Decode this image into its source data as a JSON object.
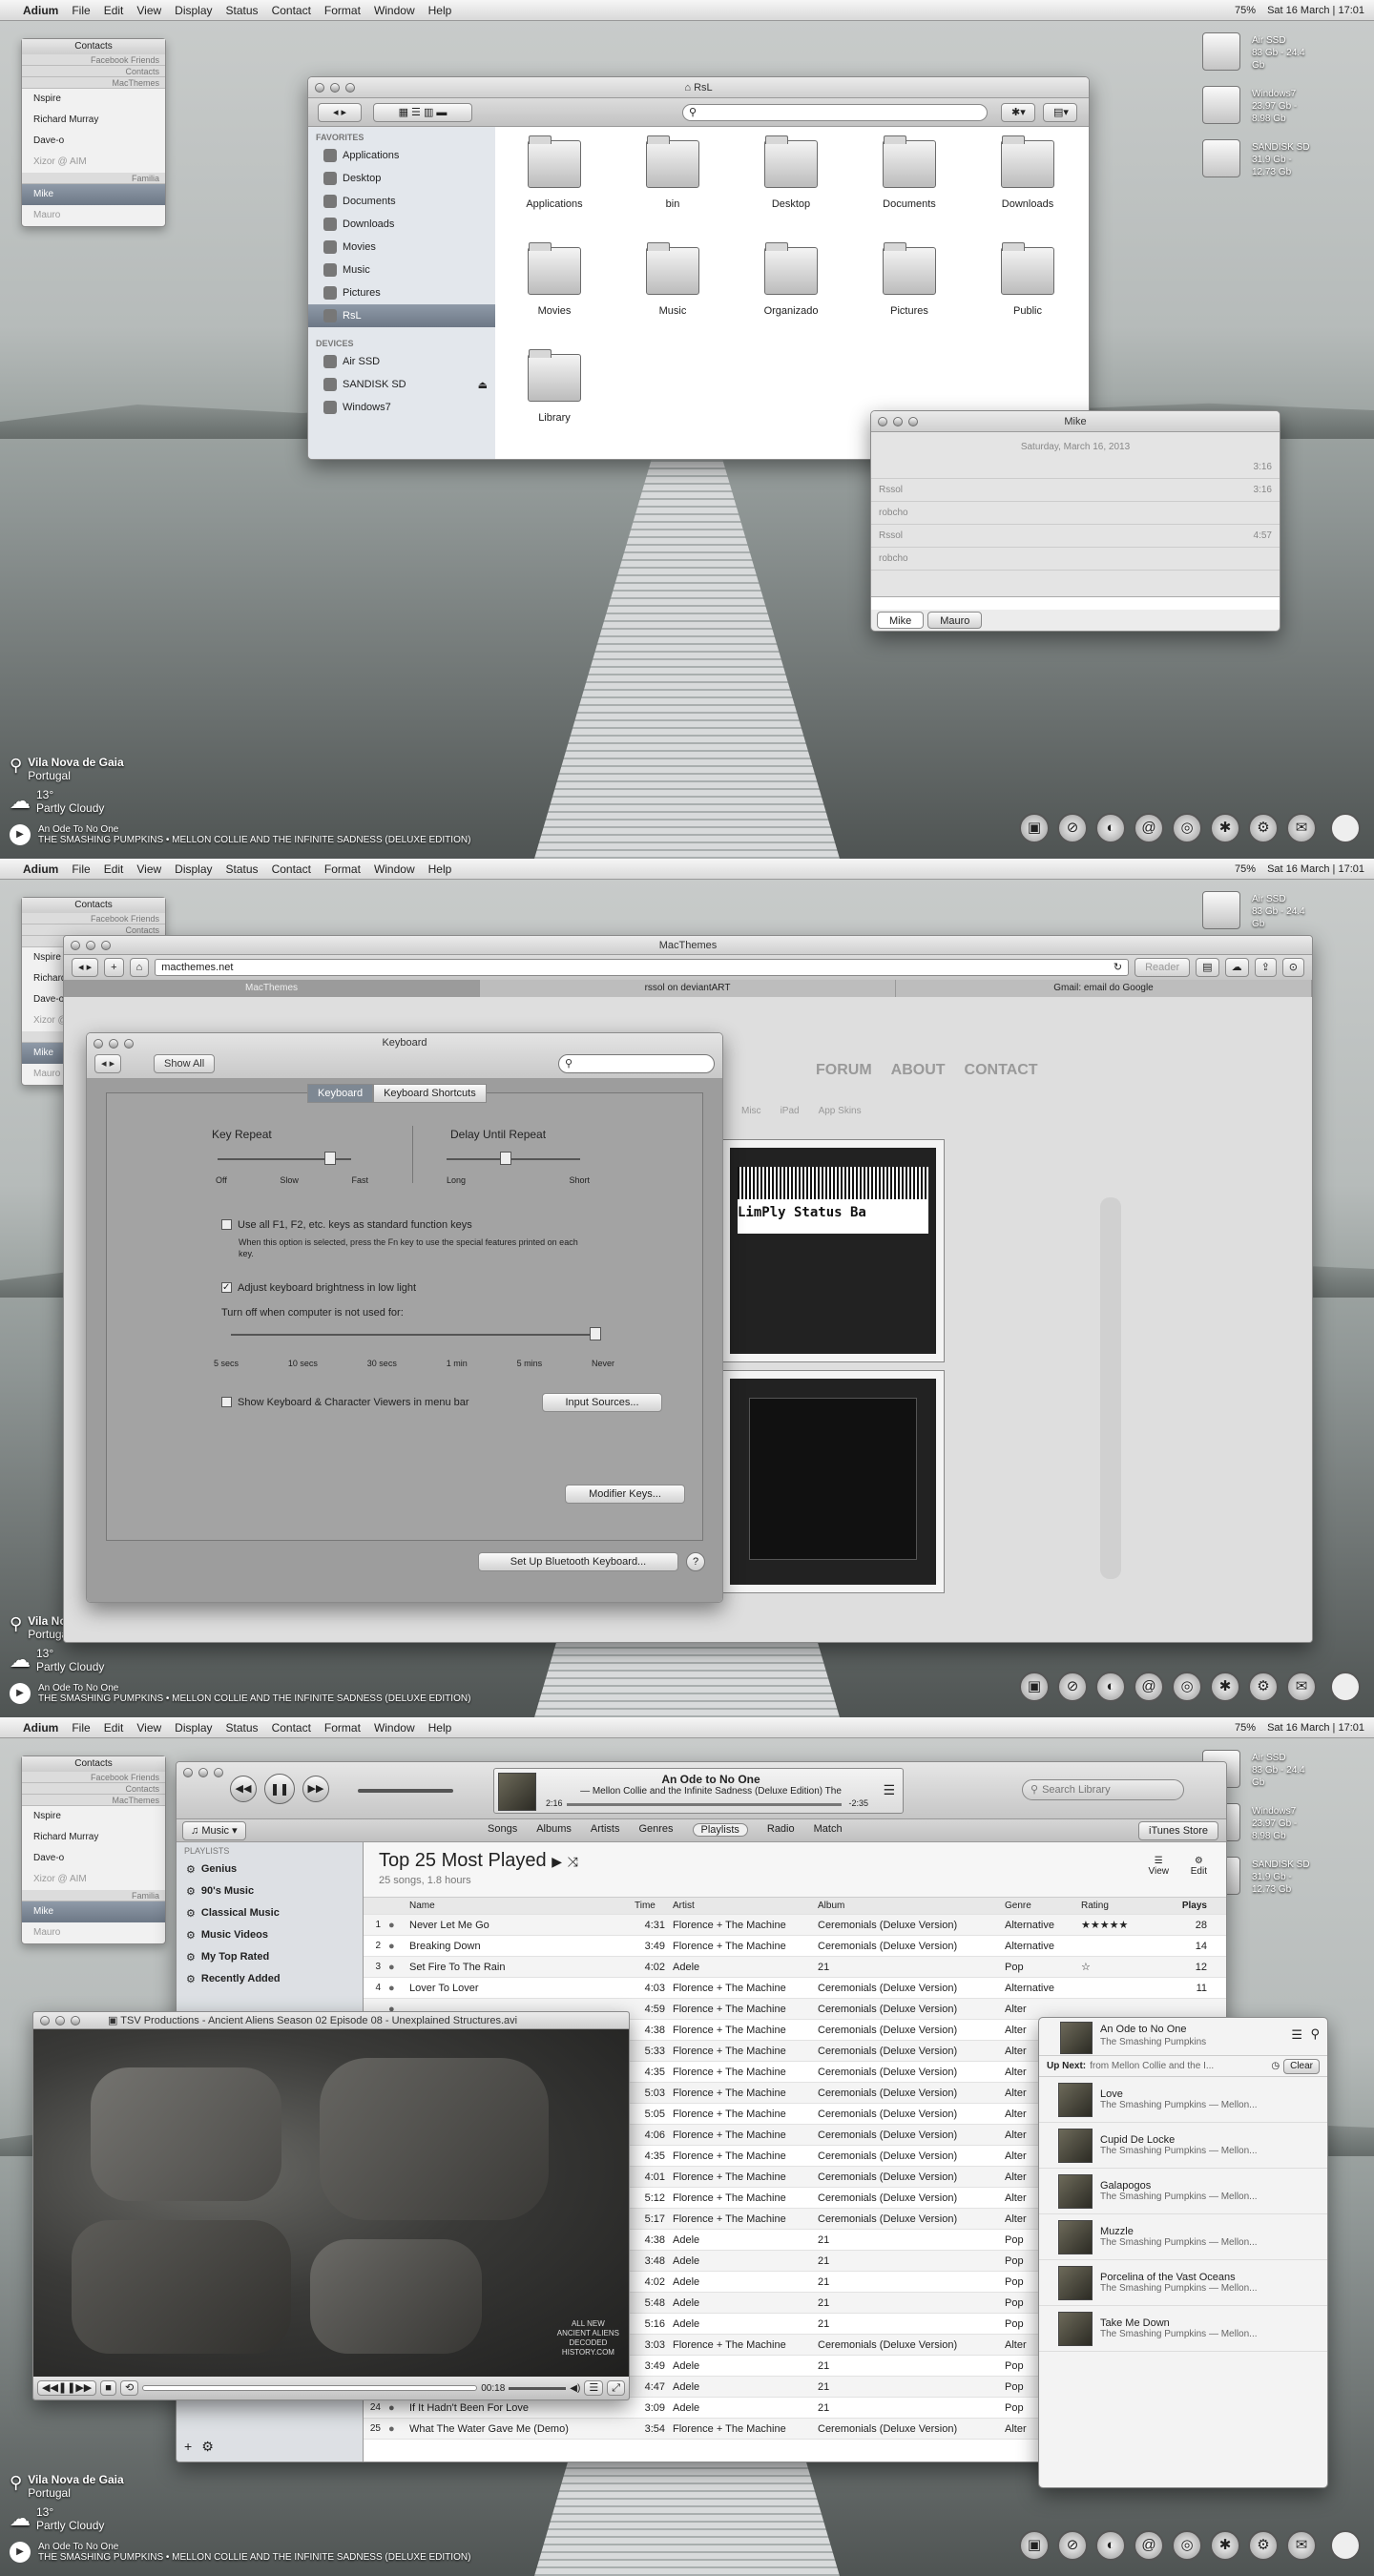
{
  "menubar": {
    "apple": "",
    "app": "Adium",
    "items": [
      "File",
      "Edit",
      "View",
      "Display",
      "Status",
      "Contact",
      "Format",
      "Window",
      "Help"
    ],
    "clock": "Sat 16 March | 17:01",
    "battery": "75%"
  },
  "contacts": {
    "title": "Contacts",
    "groups": [
      "Facebook Friends",
      "Contacts",
      "MacThemes"
    ],
    "people": [
      "Nspire",
      "Richard Murray",
      "Dave-o",
      "Xizor @ AIM"
    ],
    "group2": "Familia",
    "selected": "Mike",
    "other": "Mauro"
  },
  "drives": [
    {
      "name": "Air SSD",
      "info": "83 Gb - 24.4 Gb"
    },
    {
      "name": "Windows7",
      "info": "23.97 Gb - 8.98 Gb"
    },
    {
      "name": "SANDISK SD",
      "info": "31.9 Gb - 12.73 Gb"
    }
  ],
  "weather": {
    "city": "Vila Nova de Gaia",
    "country": "Portugal",
    "temp": "13°",
    "cond": "Partly Cloudy"
  },
  "nowplaying": {
    "title": "An Ode To No One",
    "artist": "THE SMASHING PUMPKINS • MELLON COLLIE AND THE INFINITE SADNESS (DELUXE EDITION)"
  },
  "finder": {
    "title": "RsL",
    "fav_hd": "FAVORITES",
    "dev_hd": "DEVICES",
    "favorites": [
      "Applications",
      "Desktop",
      "Documents",
      "Downloads",
      "Movies",
      "Music",
      "Pictures",
      "RsL"
    ],
    "devices": [
      "Air SSD",
      "SANDISK SD",
      "Windows7"
    ],
    "items": [
      "Applications",
      "bin",
      "Desktop",
      "Documents",
      "Downloads",
      "Movies",
      "Music",
      "Organizado",
      "Pictures",
      "Public",
      "Library"
    ]
  },
  "chat": {
    "title": "Mike",
    "date": "Saturday, March 16, 2013",
    "msgs": [
      {
        "from": "",
        "text": "",
        "time": "3:16"
      },
      {
        "from": "Rssol",
        "text": "",
        "time": "3:16"
      },
      {
        "from": "",
        "text": "robcho",
        "time": ""
      },
      {
        "from": "Rssol",
        "text": "",
        "time": "4:57"
      },
      {
        "from": "",
        "text": "robcho",
        "time": ""
      }
    ],
    "tabs": [
      "Mike",
      "Mauro"
    ]
  },
  "browser": {
    "title": "MacThemes",
    "url": "macthemes.net",
    "reader": "Reader",
    "tabs": [
      "MacThemes",
      "rssol on deviantART",
      "Gmail: email do Google"
    ],
    "nav": [
      "FORUM",
      "ABOUT",
      "CONTACT"
    ],
    "subnav": [
      "Misc",
      "iPad",
      "App Skins"
    ],
    "barcode_text": "LimPly Status Ba"
  },
  "keyboard": {
    "title": "Keyboard",
    "show_all": "Show All",
    "tabs": [
      "Keyboard",
      "Keyboard Shortcuts"
    ],
    "key_repeat": "Key Repeat",
    "delay": "Delay Until Repeat",
    "kr_labels": [
      "Off",
      "Slow",
      "Fast"
    ],
    "dr_labels": [
      "Long",
      "Short"
    ],
    "fn_label": "Use all F1, F2, etc. keys as standard function keys",
    "fn_desc": "When this option is selected, press the Fn key to use the special features printed on each key.",
    "bright_label": "Adjust keyboard brightness in low light",
    "turnoff": "Turn off when computer is not used for:",
    "turnoff_ticks": [
      "5 secs",
      "10 secs",
      "30 secs",
      "1 min",
      "5 mins",
      "Never"
    ],
    "viewer_label": "Show Keyboard & Character Viewers in menu bar",
    "input_sources": "Input Sources...",
    "modifier": "Modifier Keys...",
    "bluetooth": "Set Up Bluetooth Keyboard...",
    "help": "?"
  },
  "itunes": {
    "lcd_title": "An Ode to No One",
    "lcd_sub": "— Mellon Collie and the Infinite Sadness (Deluxe Edition)  The",
    "lcd_elapsed": "2:16",
    "lcd_remain": "-2:35",
    "search": "Search Library",
    "source": "Music",
    "topnav": [
      "Songs",
      "Albums",
      "Artists",
      "Genres",
      "Playlists",
      "Radio",
      "Match"
    ],
    "store": "iTunes Store",
    "playlists_hd": "PLAYLISTS",
    "playlists": [
      "Genius",
      "90's Music",
      "Classical Music",
      "Music Videos",
      "My Top Rated",
      "Recently Added"
    ],
    "pl_title": "Top 25 Most Played",
    "pl_sub": "25 songs, 1.8 hours",
    "view": "View",
    "edit": "Edit",
    "cols": [
      "Name",
      "Time",
      "Artist",
      "Album",
      "Genre",
      "Rating",
      "Plays"
    ],
    "rows": [
      {
        "n": "1",
        "name": "Never Let Me Go",
        "time": "4:31",
        "artist": "Florence + The Machine",
        "album": "Ceremonials (Deluxe Version)",
        "genre": "Alternative",
        "rating": "★★★★★",
        "plays": "28"
      },
      {
        "n": "2",
        "name": "Breaking Down",
        "time": "3:49",
        "artist": "Florence + The Machine",
        "album": "Ceremonials (Deluxe Version)",
        "genre": "Alternative",
        "rating": "",
        "plays": "14"
      },
      {
        "n": "3",
        "name": "Set Fire To The Rain",
        "time": "4:02",
        "artist": "Adele",
        "album": "21",
        "genre": "Pop",
        "rating": "☆",
        "plays": "12"
      },
      {
        "n": "4",
        "name": "Lover To Lover",
        "time": "4:03",
        "artist": "Florence + The Machine",
        "album": "Ceremonials (Deluxe Version)",
        "genre": "Alternative",
        "rating": "",
        "plays": "11"
      },
      {
        "n": "",
        "name": "",
        "time": "4:59",
        "artist": "Florence + The Machine",
        "album": "Ceremonials (Deluxe Version)",
        "genre": "Alter",
        "rating": "",
        "plays": ""
      },
      {
        "n": "",
        "name": "",
        "time": "4:38",
        "artist": "Florence + The Machine",
        "album": "Ceremonials (Deluxe Version)",
        "genre": "Alter",
        "rating": "",
        "plays": ""
      },
      {
        "n": "",
        "name": "",
        "time": "5:33",
        "artist": "Florence + The Machine",
        "album": "Ceremonials (Deluxe Version)",
        "genre": "Alter",
        "rating": "",
        "plays": ""
      },
      {
        "n": "",
        "name": "",
        "time": "4:35",
        "artist": "Florence + The Machine",
        "album": "Ceremonials (Deluxe Version)",
        "genre": "Alter",
        "rating": "",
        "plays": ""
      },
      {
        "n": "",
        "name": "",
        "time": "5:03",
        "artist": "Florence + The Machine",
        "album": "Ceremonials (Deluxe Version)",
        "genre": "Alter",
        "rating": "",
        "plays": ""
      },
      {
        "n": "",
        "name": "",
        "time": "5:05",
        "artist": "Florence + The Machine",
        "album": "Ceremonials (Deluxe Version)",
        "genre": "Alter",
        "rating": "",
        "plays": ""
      },
      {
        "n": "",
        "name": "",
        "time": "4:06",
        "artist": "Florence + The Machine",
        "album": "Ceremonials (Deluxe Version)",
        "genre": "Alter",
        "rating": "",
        "plays": ""
      },
      {
        "n": "",
        "name": "",
        "time": "4:35",
        "artist": "Florence + The Machine",
        "album": "Ceremonials (Deluxe Version)",
        "genre": "Alter",
        "rating": "",
        "plays": ""
      },
      {
        "n": "",
        "name": "",
        "time": "4:01",
        "artist": "Florence + The Machine",
        "album": "Ceremonials (Deluxe Version)",
        "genre": "Alter",
        "rating": "",
        "plays": ""
      },
      {
        "n": "",
        "name": "",
        "time": "5:12",
        "artist": "Florence + The Machine",
        "album": "Ceremonials (Deluxe Version)",
        "genre": "Alter",
        "rating": "",
        "plays": ""
      },
      {
        "n": "",
        "name": "",
        "time": "5:17",
        "artist": "Florence + The Machine",
        "album": "Ceremonials (Deluxe Version)",
        "genre": "Alter",
        "rating": "",
        "plays": ""
      },
      {
        "n": "",
        "name": "",
        "time": "4:38",
        "artist": "Adele",
        "album": "21",
        "genre": "Pop",
        "rating": "",
        "plays": ""
      },
      {
        "n": "",
        "name": "",
        "time": "3:48",
        "artist": "Adele",
        "album": "21",
        "genre": "Pop",
        "rating": "",
        "plays": ""
      },
      {
        "n": "",
        "name": "",
        "time": "4:02",
        "artist": "Adele",
        "album": "21",
        "genre": "Pop",
        "rating": "",
        "plays": ""
      },
      {
        "n": "",
        "name": "",
        "time": "5:48",
        "artist": "Adele",
        "album": "21",
        "genre": "Pop",
        "rating": "",
        "plays": ""
      },
      {
        "n": "",
        "name": "",
        "time": "5:16",
        "artist": "Adele",
        "album": "21",
        "genre": "Pop",
        "rating": "",
        "plays": ""
      },
      {
        "n": "",
        "name": "",
        "time": "3:03",
        "artist": "Florence + The Machine",
        "album": "Ceremonials (Deluxe Version)",
        "genre": "Alter",
        "rating": "",
        "plays": ""
      },
      {
        "n": "",
        "name": "",
        "time": "3:49",
        "artist": "Adele",
        "album": "21",
        "genre": "Pop",
        "rating": "",
        "plays": ""
      },
      {
        "n": "",
        "name": "",
        "time": "4:47",
        "artist": "Adele",
        "album": "21",
        "genre": "Pop",
        "rating": "",
        "plays": ""
      },
      {
        "n": "24",
        "name": "If It Hadn't Been For Love",
        "time": "3:09",
        "artist": "Adele",
        "album": "21",
        "genre": "Pop",
        "rating": "",
        "plays": ""
      },
      {
        "n": "25",
        "name": "What The Water Gave Me (Demo)",
        "time": "3:54",
        "artist": "Florence + The Machine",
        "album": "Ceremonials (Deluxe Version)",
        "genre": "Alter",
        "rating": "",
        "plays": ""
      }
    ]
  },
  "video": {
    "title": "TSV Productions - Ancient Aliens Season 02 Episode 08 - Unexplained Structures.avi",
    "watermark": "ALL NEW\nANCIENT ALIENS\nDECODED\nHISTORY.COM",
    "time": "00:18"
  },
  "upnext": {
    "song": "An Ode to No One",
    "artist": "The Smashing Pumpkins",
    "label": "Up Next:",
    "from": "from Mellon Collie and the I...",
    "clear": "Clear",
    "items": [
      {
        "t": "Love",
        "a": "The Smashing Pumpkins — Mellon..."
      },
      {
        "t": "Cupid De Locke",
        "a": "The Smashing Pumpkins — Mellon..."
      },
      {
        "t": "Galapogos",
        "a": "The Smashing Pumpkins — Mellon..."
      },
      {
        "t": "Muzzle",
        "a": "The Smashing Pumpkins — Mellon..."
      },
      {
        "t": "Porcelina of the Vast Oceans",
        "a": "The Smashing Pumpkins — Mellon..."
      },
      {
        "t": "Take Me Down",
        "a": "The Smashing Pumpkins — Mellon..."
      }
    ]
  },
  "dock_icons": [
    "▣",
    "⊘",
    "◐",
    "@",
    "◎",
    "✱",
    "⚙",
    "✉"
  ]
}
